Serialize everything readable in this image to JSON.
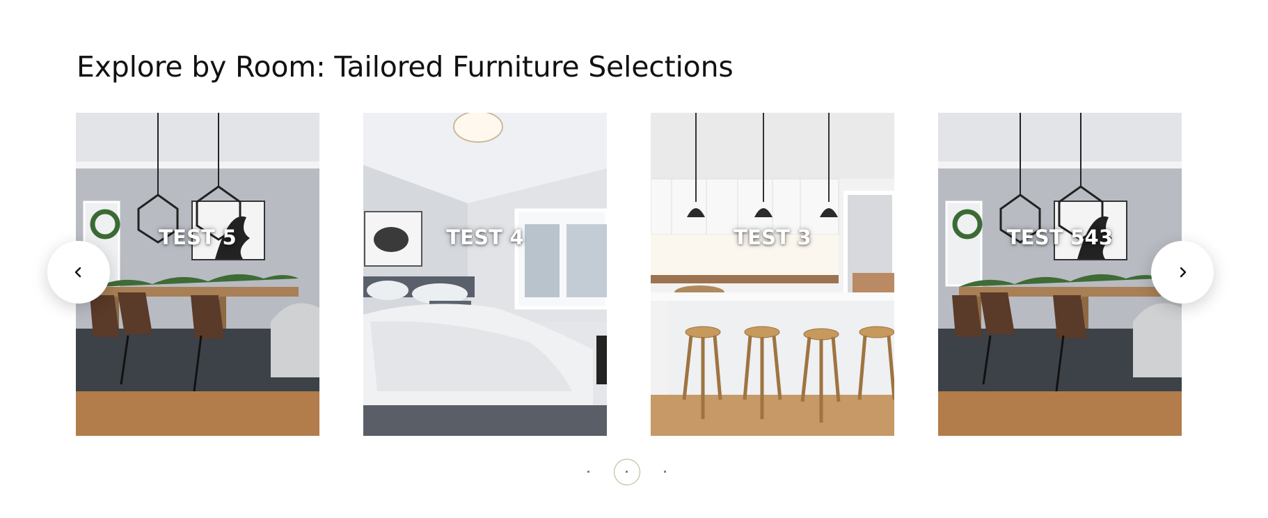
{
  "section": {
    "title": "Explore by Room: Tailored Furniture Selections"
  },
  "carousel": {
    "prev_icon": "chevron-left-icon",
    "next_icon": "chevron-right-icon",
    "slides": [
      {
        "label": "TEST 5",
        "scene": "dining-room"
      },
      {
        "label": "TEST 4",
        "scene": "bedroom"
      },
      {
        "label": "TEST 3",
        "scene": "kitchen"
      },
      {
        "label": "TEST 543",
        "scene": "dining-room"
      }
    ],
    "pagination": {
      "count": 3,
      "active": 2
    }
  },
  "colors": {
    "active_dot_ring": "#b9b08a",
    "label_text": "#ffffff"
  }
}
